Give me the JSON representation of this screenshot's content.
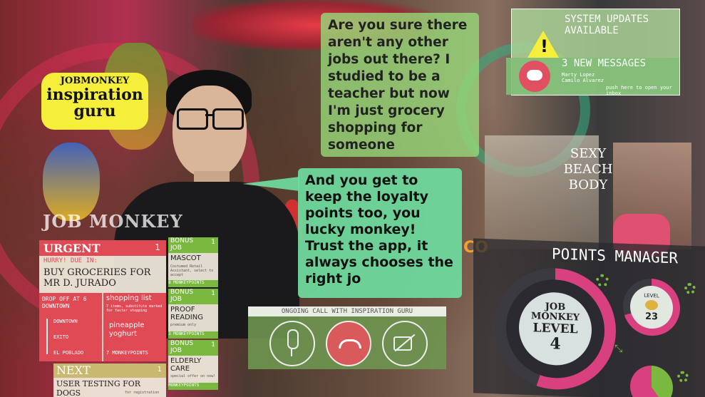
{
  "badge": {
    "line1": "JOBMONKEY",
    "line2": "inspiration",
    "line3": "guru"
  },
  "system": {
    "title": "SYSTEM UPDATES AVAILABLE",
    "messages": "3 NEW MESSAGES",
    "contacts": "Marty Lopez\nCamilo Alvarez",
    "prompt": "push here to open your inbox"
  },
  "question": "Are you sure there aren't any other jobs out there? I studied to be a teacher but now I'm just grocery shopping for someone",
  "reply": "And you get to keep the loyalty points too, you lucky monkey! Trust the app, it always chooses the right jo",
  "jobmonkey_title": "JOB MONKEY",
  "urgent": {
    "header": "URGENT",
    "badge": "1",
    "sub": "HURRY!  DUE IN:",
    "title": "BUY GROCERIES FOR MR D. JURADO",
    "dropoff": "DROP OFF AT 6 DOWNTOWN",
    "stops": [
      "DOWNTOWN",
      "EXITO",
      "EL POBLADO"
    ],
    "list_title": "shopping list",
    "list_note": "7 items, substitute marked for faster shopping",
    "items": [
      "pineapple",
      "yoghurt"
    ],
    "points": "7 MONKEYPOINTS"
  },
  "bonus_jobs": [
    {
      "header": "BONUS JOB",
      "badge": "1",
      "title": "MASCOT",
      "desc": "Costumed Retail Assistant, select to accept",
      "points": "8 MONKEYPOINTS"
    },
    {
      "header": "BONUS JOB",
      "badge": "1",
      "title": "PROOF READING",
      "desc": "premium only",
      "points": "3 MONKEYPOINTS"
    },
    {
      "header": "BONUS JOB",
      "badge": "1",
      "title": "ELDERLY CARE",
      "desc": "special offer on now!",
      "points": "MONKEYPOINTS"
    }
  ],
  "next": {
    "header": "NEXT",
    "badge": "1",
    "title": "USER TESTING FOR DOGS",
    "desc": "for registration"
  },
  "call": {
    "label": "ONGOING CALL WITH INSPIRATION GURU"
  },
  "points": {
    "title": "POINTS MANAGER",
    "level_badge": "JOB MONKEY LEVEL 4",
    "l1": "JOB",
    "l2": "MONKEY",
    "l3": "LEVEL",
    "l4": "4",
    "small_level": "LEVEL",
    "small_num": "23"
  },
  "bg_signs": {
    "body": "SEXY BEACH BODY",
    "co": "CO"
  }
}
